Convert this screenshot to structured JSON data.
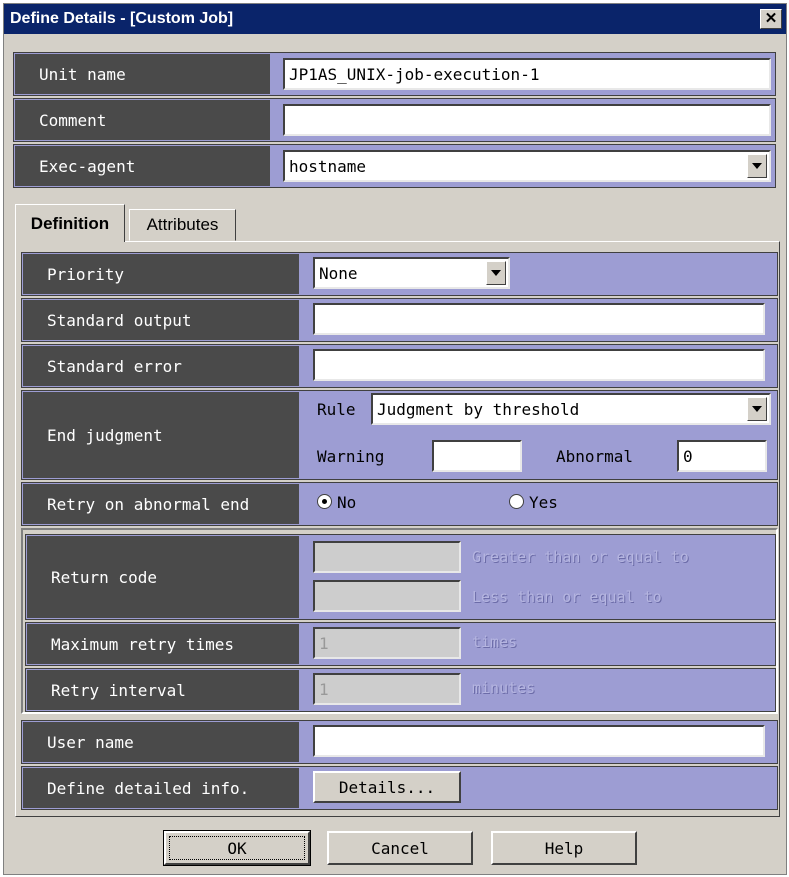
{
  "window": {
    "title": "Define Details - [Custom Job]",
    "close_glyph": "✕"
  },
  "header_fields": {
    "unit_name": {
      "label": "Unit name",
      "value": "JP1AS_UNIX-job-execution-1"
    },
    "comment": {
      "label": "Comment",
      "value": ""
    },
    "exec_agent": {
      "label": "Exec-agent",
      "value": "hostname"
    }
  },
  "tabs": [
    {
      "label": "Definition",
      "active": true
    },
    {
      "label": "Attributes",
      "active": false
    }
  ],
  "definition": {
    "priority": {
      "label": "Priority",
      "value": "None"
    },
    "standard_output": {
      "label": "Standard output",
      "value": ""
    },
    "standard_error": {
      "label": "Standard error",
      "value": ""
    },
    "end_judgment": {
      "label": "End judgment",
      "rule_label": "Rule",
      "rule_value": "Judgment by threshold",
      "warning_label": "Warning",
      "warning_value": "",
      "abnormal_label": "Abnormal",
      "abnormal_value": "0"
    },
    "retry": {
      "label": "Retry on abnormal end",
      "option_no": "No",
      "option_yes": "Yes",
      "selected": "No"
    },
    "return_code": {
      "label": "Return code",
      "gte_text": "Greater than or equal to",
      "lte_text": "Less than or equal to",
      "gte_value": "",
      "lte_value": ""
    },
    "max_retry": {
      "label": "Maximum retry times",
      "value": "1",
      "unit": "times"
    },
    "retry_interval": {
      "label": "Retry interval",
      "value": "1",
      "unit": "minutes"
    },
    "user_name": {
      "label": "User name",
      "value": ""
    },
    "detailed_info": {
      "label": "Define detailed info.",
      "button": "Details..."
    }
  },
  "footer": {
    "ok": "OK",
    "cancel": "Cancel",
    "help": "Help"
  },
  "colors": {
    "title_bar": "#0a246a",
    "label_bg": "#4a4a4a",
    "field_panel": "#9d9dd3",
    "dialog_bg": "#d4d0c8"
  }
}
